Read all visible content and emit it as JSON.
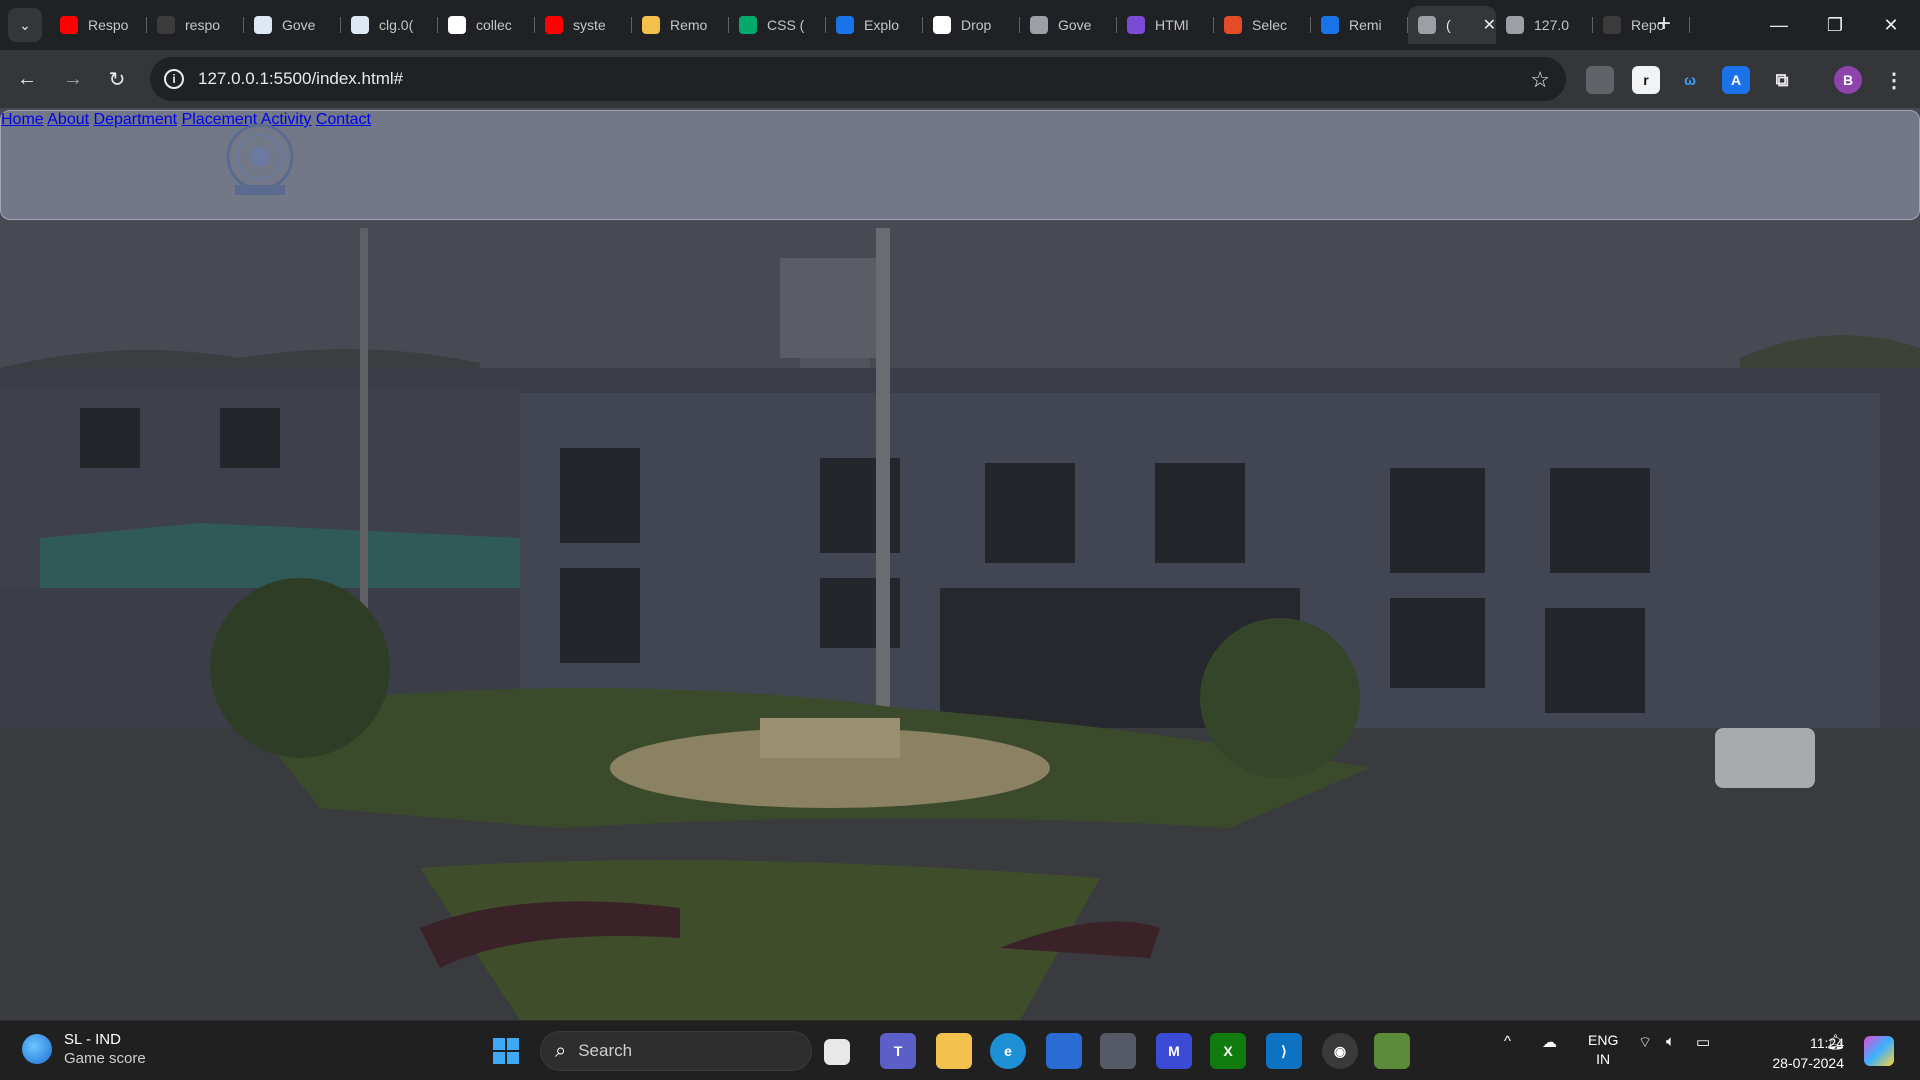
{
  "browser": {
    "tabs": [
      {
        "title": "Respo",
        "icon": "youtube-icon",
        "color": "#ff0000"
      },
      {
        "title": "respo",
        "icon": "github-icon",
        "color": "#3c3c3c"
      },
      {
        "title": "Gove",
        "icon": "page-icon",
        "color": "#dfe7f3"
      },
      {
        "title": "clg.0(",
        "icon": "page-icon",
        "color": "#dfe7f3"
      },
      {
        "title": "collec",
        "icon": "google-icon",
        "color": "#ffffff"
      },
      {
        "title": "syste",
        "icon": "youtube-icon",
        "color": "#ff0000"
      },
      {
        "title": "Remo",
        "icon": "notes-icon",
        "color": "#f3c14b"
      },
      {
        "title": "CSS (",
        "icon": "w3-icon",
        "color": "#04aa6d"
      },
      {
        "title": "Explo",
        "icon": "circle-c-icon",
        "color": "#1a73e8"
      },
      {
        "title": "Drop",
        "icon": "openai-icon",
        "color": "#ffffff"
      },
      {
        "title": "Gove",
        "icon": "globe-icon",
        "color": "#9aa0a6"
      },
      {
        "title": "HTMl",
        "icon": "six-icon",
        "color": "#7b4bd6"
      },
      {
        "title": "Selec",
        "icon": "zoho-icon",
        "color": "#e34c26"
      },
      {
        "title": "Remi",
        "icon": "flag-icon",
        "color": "#1a73e8"
      },
      {
        "title": "(",
        "icon": "globe-icon",
        "color": "#9aa0a6",
        "active": true
      },
      {
        "title": "127.0",
        "icon": "globe-icon",
        "color": "#9aa0a6"
      },
      {
        "title": "Repo",
        "icon": "github-icon",
        "color": "#3c3c3c"
      }
    ],
    "url": "127.0.0.1:5500/index.html#",
    "profile_initial": "B"
  },
  "site": {
    "menu": [
      "Home",
      "About",
      "Department",
      "Placement",
      "Activity",
      "Contact"
    ]
  },
  "taskbar": {
    "weather_title": "SL - IND",
    "weather_sub": "Game score",
    "search_label": "Search",
    "lang_top": "ENG",
    "lang_bottom": "IN",
    "time": "11:24",
    "date": "28-07-2024"
  },
  "colors": {
    "accent": "#1a73e8",
    "profile": "#8e44ad"
  }
}
